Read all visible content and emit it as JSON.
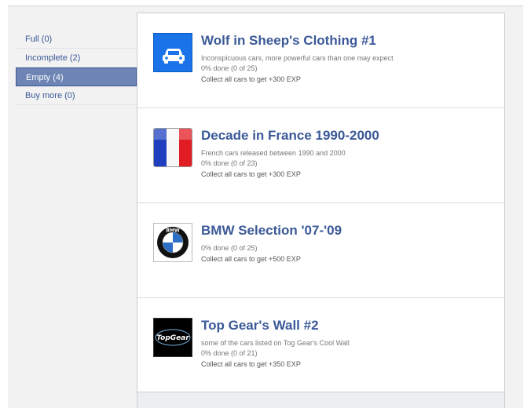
{
  "sidebar": {
    "items": [
      {
        "label": "Full (0)",
        "selected": false
      },
      {
        "label": "Incomplete (2)",
        "selected": false
      },
      {
        "label": "Empty (4)",
        "selected": true
      },
      {
        "label": "Buy more (0)",
        "selected": false
      }
    ]
  },
  "collections": [
    {
      "title": "Wolf in Sheep's Clothing #1",
      "description": "Inconspicuous cars, more powerful cars than one may expect",
      "progress": "0% done (0 of 25)",
      "reward": "Collect all cars to get +300 EXP",
      "icon": "car-icon"
    },
    {
      "title": "Decade in France 1990-2000",
      "description": "French cars released between 1990 and 2000",
      "progress": "0% done (0 of 23)",
      "reward": "Collect all cars to get +300 EXP",
      "icon": "french-flag-icon"
    },
    {
      "title": "BMW Selection '07-'09",
      "description": "",
      "progress": "0% done (0 of 25)",
      "reward": "Collect all cars to get +500 EXP",
      "icon": "bmw-logo-icon",
      "logo_text": "BMW"
    },
    {
      "title": "Top Gear's Wall #2",
      "description": "some of the cars listed on Tog Gear's Cool Wall",
      "progress": "0% done (0 of 21)",
      "reward": "Collect all cars to get +350 EXP",
      "icon": "top-gear-logo-icon",
      "logo_text": "TopGear"
    }
  ],
  "colors": {
    "link": "#3b5998",
    "selected_bg": "#6d84b4",
    "car_icon_bg": "#1a73e8",
    "flag_blue": "#1f3fbf",
    "flag_red": "#e21c23"
  }
}
